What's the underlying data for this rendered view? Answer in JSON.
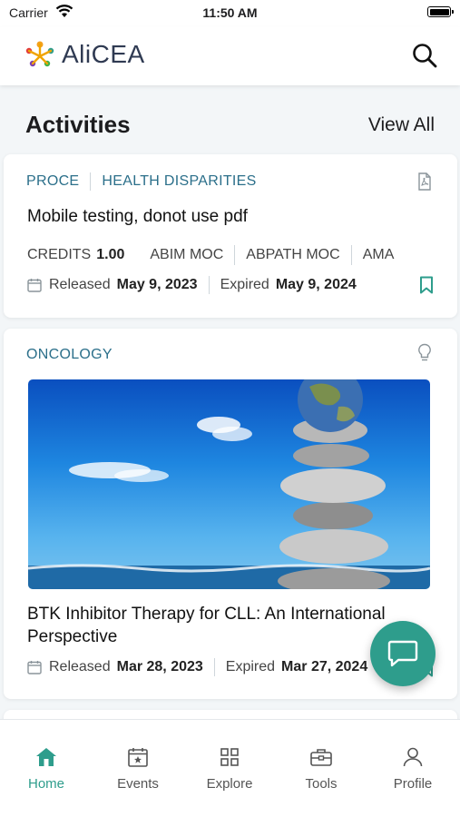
{
  "status_bar": {
    "carrier": "Carrier",
    "time": "11:50 AM"
  },
  "header": {
    "logo_text": "AliCEA",
    "icons": {
      "search": "search-icon",
      "logo": "alicea-logo-icon"
    }
  },
  "section": {
    "title": "Activities",
    "view_all": "View All"
  },
  "cards": [
    {
      "tags": [
        "PROCE",
        "HEALTH DISPARITIES"
      ],
      "type_icon": "pdf-icon",
      "title": "Mobile testing, donot use pdf",
      "credits_label": "CREDITS",
      "credits_value": "1.00",
      "accreditations": [
        "ABIM MOC",
        "ABPATH MOC",
        "AMA"
      ],
      "released_label": "Released",
      "released_date": "May 9, 2023",
      "expired_label": "Expired",
      "expired_date": "May 9, 2024",
      "bookmark_icon": "bookmark-icon"
    },
    {
      "tags": [
        "ONCOLOGY"
      ],
      "type_icon": "lightbulb-icon",
      "image_alt": "Stacked stones under blue sky with globe",
      "title_line1": "BTK Inhibitor Therapy for CLL: An International",
      "title_line2": "Perspective",
      "released_label": "Released",
      "released_date": "Mar 28, 2023",
      "expired_label": "Expired",
      "expired_date": "Mar 27, 2024",
      "bookmark_icon": "bookmark-icon"
    }
  ],
  "chat_fab": {
    "icon": "chat-icon"
  },
  "tab_bar": {
    "active_color": "#2e9d8c",
    "tabs": [
      {
        "label": "Home",
        "icon": "home-icon",
        "active": true
      },
      {
        "label": "Events",
        "icon": "calendar-star-icon",
        "active": false
      },
      {
        "label": "Explore",
        "icon": "grid-icon",
        "active": false
      },
      {
        "label": "Tools",
        "icon": "toolbox-icon",
        "active": false
      },
      {
        "label": "Profile",
        "icon": "person-icon",
        "active": false
      }
    ]
  },
  "colors": {
    "accent": "#2e9d8c",
    "tag": "#2b6f8a",
    "title_dark": "#2f3a52"
  }
}
